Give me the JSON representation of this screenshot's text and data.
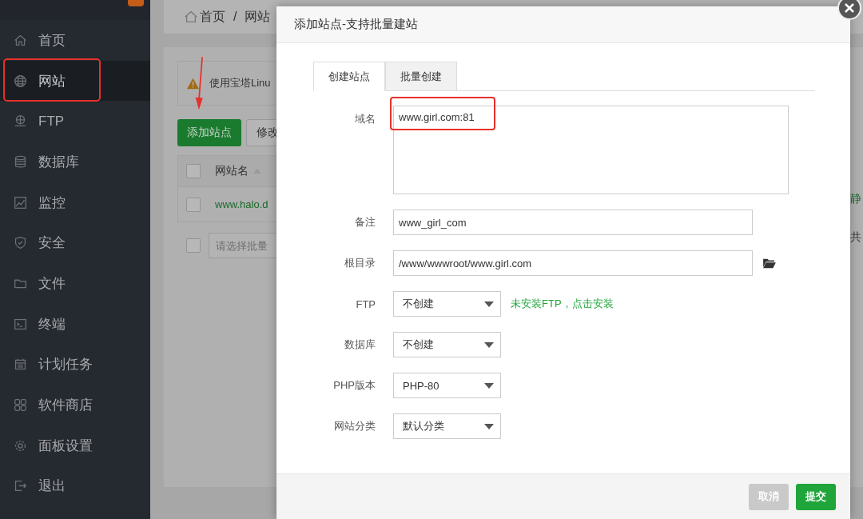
{
  "sidebar": {
    "items": [
      {
        "label": "首页",
        "selected": false,
        "annotated": false
      },
      {
        "label": "网站",
        "selected": true,
        "annotated": true
      },
      {
        "label": "FTP",
        "selected": false,
        "annotated": false
      },
      {
        "label": "数据库",
        "selected": false,
        "annotated": false
      },
      {
        "label": "监控",
        "selected": false,
        "annotated": false
      },
      {
        "label": "安全",
        "selected": false,
        "annotated": false
      },
      {
        "label": "文件",
        "selected": false,
        "annotated": false
      },
      {
        "label": "终端",
        "selected": false,
        "annotated": false
      },
      {
        "label": "计划任务",
        "selected": false,
        "annotated": false
      },
      {
        "label": "软件商店",
        "selected": false,
        "annotated": false
      },
      {
        "label": "面板设置",
        "selected": false,
        "annotated": false
      },
      {
        "label": "退出",
        "selected": false,
        "annotated": false
      }
    ]
  },
  "page": {
    "breadcrumb": [
      "首页",
      "/",
      "网站"
    ],
    "notice": "使用宝塔Linu",
    "buttons": [
      {
        "label": "添加站点",
        "kind": "primary"
      },
      {
        "label": "修改",
        "kind": "default"
      }
    ],
    "table": {
      "all_selected": false,
      "columns": [
        "网站名"
      ],
      "rows": [
        {
          "name": "www.halo.d",
          "selected": false
        }
      ]
    },
    "batch": {
      "selected": false,
      "placeholder": "请选择批量"
    },
    "right_edge": [
      "静",
      "共"
    ]
  },
  "modal": {
    "title": "添加站点-支持批量建站",
    "tabs": [
      {
        "label": "创建站点",
        "selected": true
      },
      {
        "label": "批量创建",
        "selected": false
      }
    ],
    "fields": [
      {
        "label": "域名",
        "kind": "textarea",
        "value": "www.girl.com:81",
        "annotated": true
      },
      {
        "label": "备注",
        "kind": "text",
        "value": "www_girl_com"
      },
      {
        "label": "根目录",
        "kind": "path",
        "value": "/www/wwwroot/www.girl.com"
      },
      {
        "label": "FTP",
        "kind": "select",
        "value": "不创建",
        "hint": "未安装FTP，点击安装"
      },
      {
        "label": "数据库",
        "kind": "select",
        "value": "不创建"
      },
      {
        "label": "PHP版本",
        "kind": "select",
        "value": "PHP-80"
      },
      {
        "label": "网站分类",
        "kind": "select",
        "value": "默认分类"
      }
    ],
    "buttons": [
      {
        "label": "取消",
        "disabled": true
      },
      {
        "label": "提交",
        "disabled": false
      }
    ]
  }
}
